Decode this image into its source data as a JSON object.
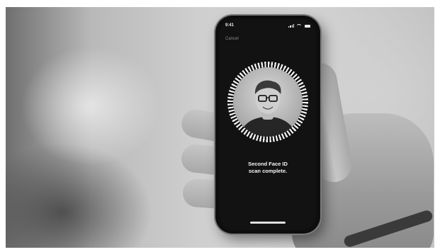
{
  "status_bar": {
    "time": "9:41"
  },
  "header": {
    "cancel_label": "Cancel"
  },
  "face_id": {
    "message_line1": "Second Face ID",
    "message_line2": "scan complete."
  },
  "colors": {
    "screen_background": "#121212",
    "ring_color": "#f3f3f3",
    "text_primary": "#f5f5f5",
    "cancel_text": "#8a8a8a"
  },
  "icons": [
    "signal-icon",
    "wifi-icon",
    "battery-icon"
  ]
}
